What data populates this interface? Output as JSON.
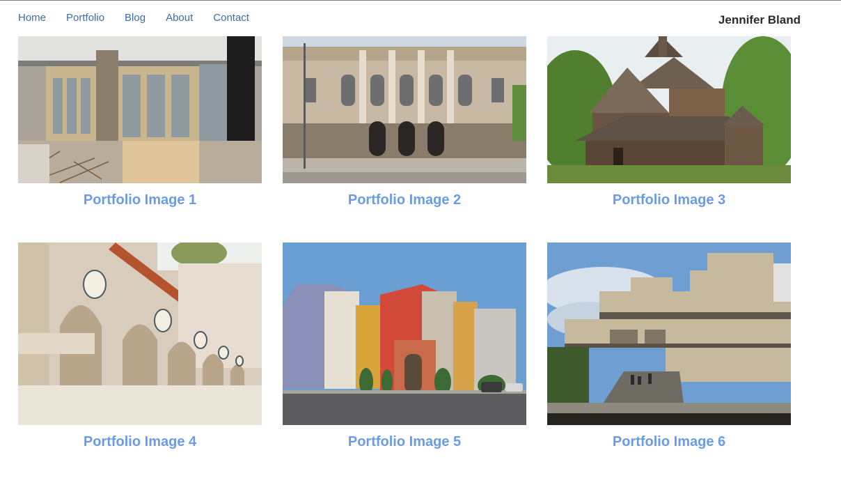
{
  "nav": {
    "items": [
      {
        "label": "Home"
      },
      {
        "label": "Portfolio"
      },
      {
        "label": "Blog"
      },
      {
        "label": "About"
      },
      {
        "label": "Contact"
      }
    ]
  },
  "brand": {
    "name": "Jennifer Bland"
  },
  "portfolio": {
    "items": [
      {
        "caption": "Portfolio Image 1"
      },
      {
        "caption": "Portfolio Image 2"
      },
      {
        "caption": "Portfolio Image 3"
      },
      {
        "caption": "Portfolio Image 4"
      },
      {
        "caption": "Portfolio Image 5"
      },
      {
        "caption": "Portfolio Image 6"
      }
    ]
  },
  "colors": {
    "nav_link": "#3a6ea5",
    "caption": "#6b9be6",
    "brand": "#2b2b2b"
  }
}
